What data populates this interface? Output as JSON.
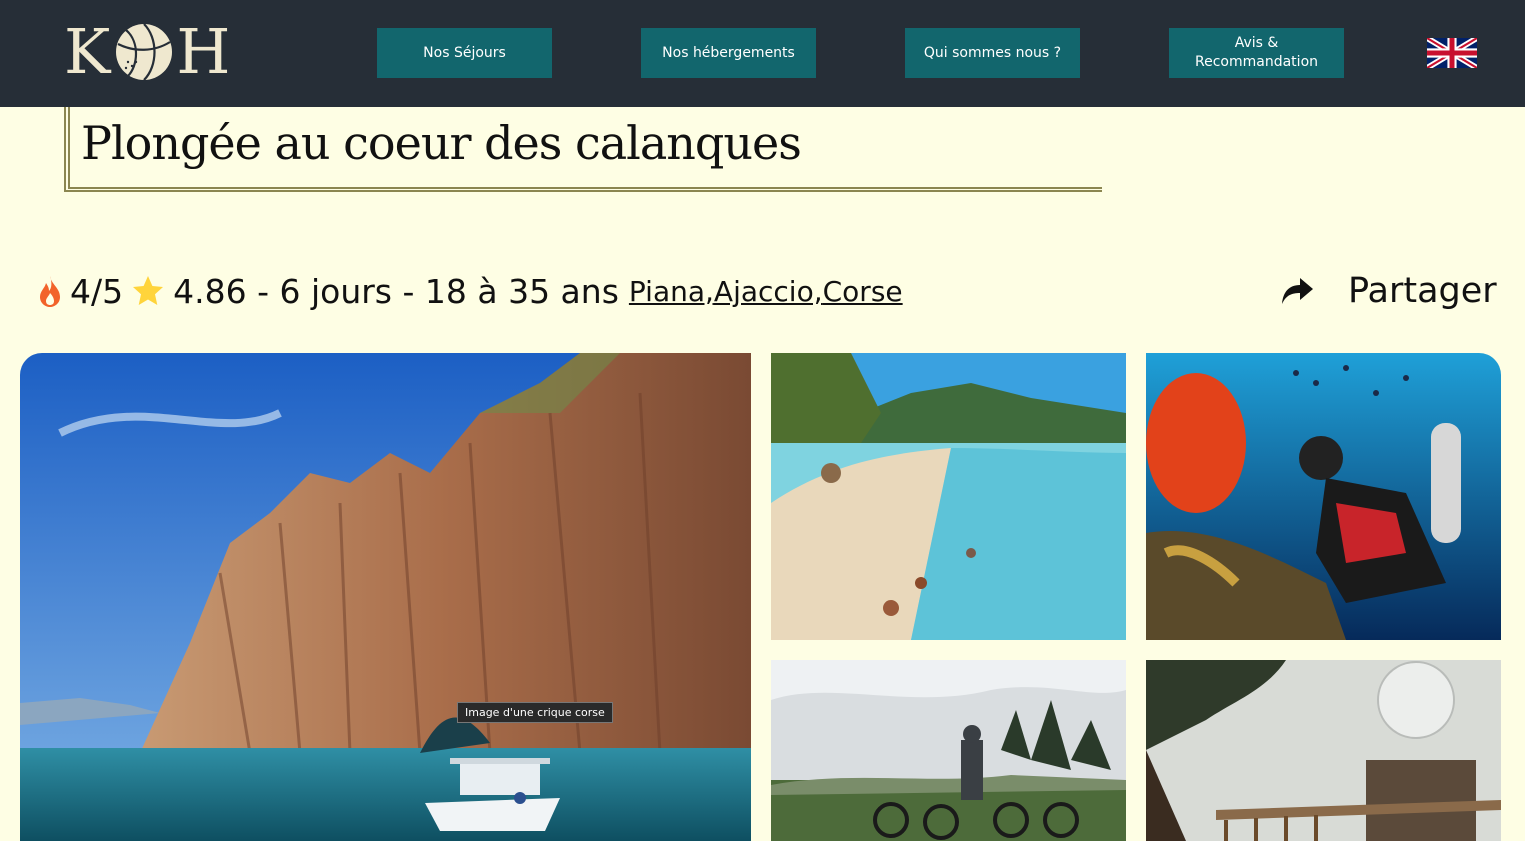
{
  "header": {
    "logo": {
      "left": "K",
      "right": "H",
      "alt": "KOH"
    },
    "nav": [
      {
        "label": "Nos Séjours"
      },
      {
        "label": "Nos hébergements"
      },
      {
        "label": "Qui sommes nous ?"
      },
      {
        "label": "Avis & Recommandation"
      }
    ],
    "language_flag": "uk-flag-icon"
  },
  "page": {
    "title": "Plongée au coeur des calanques"
  },
  "info": {
    "difficulty": "4/5",
    "rating": "4.86",
    "details": " - 6 jours - 18 à 35 ans",
    "locations": [
      "Piana,",
      "Ajaccio,",
      "Corse"
    ]
  },
  "share": {
    "label": "Partager"
  },
  "gallery": {
    "tooltip": "Image d'une crique corse"
  },
  "colors": {
    "header_bg": "#262e37",
    "nav_bg": "#12666d",
    "page_bg": "#fefee4",
    "title_border": "#8b8650",
    "flame": "#f2632a",
    "star": "#ffd43b"
  }
}
